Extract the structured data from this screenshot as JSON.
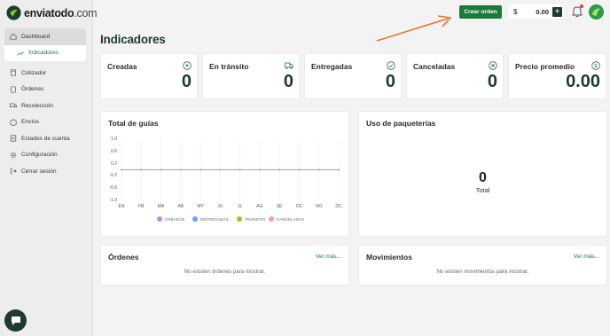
{
  "brand": {
    "name": "enviatodo",
    "domain": ".com"
  },
  "sidebar": {
    "items": [
      {
        "label": "Dashboard",
        "icon": "home-icon"
      },
      {
        "label": "Indicadores",
        "icon": "trend-icon"
      },
      {
        "label": "Cotizador",
        "icon": "calculator-icon"
      },
      {
        "label": "Órdenes",
        "icon": "orders-icon"
      },
      {
        "label": "Recolección",
        "icon": "truck-icon"
      },
      {
        "label": "Envíos",
        "icon": "box-icon"
      },
      {
        "label": "Estados de cuenta",
        "icon": "statement-icon"
      },
      {
        "label": "Configuración",
        "icon": "gear-icon"
      },
      {
        "label": "Cerrar sesión",
        "icon": "logout-icon"
      }
    ]
  },
  "topbar": {
    "create_order": "Crear orden",
    "currency": "$",
    "balance": "0.00",
    "add": "+"
  },
  "page": {
    "title": "Indicadores"
  },
  "kpis": [
    {
      "label": "Creadas",
      "value": "0",
      "icon": "plus-circle-icon"
    },
    {
      "label": "En tránsito",
      "value": "0",
      "icon": "truck-icon"
    },
    {
      "label": "Entregadas",
      "value": "0",
      "icon": "check-circle-icon"
    },
    {
      "label": "Canceladas",
      "value": "0",
      "icon": "x-circle-icon"
    },
    {
      "label": "Precio promedio",
      "value": "0.00",
      "icon": "dollar-circle-icon"
    }
  ],
  "guides": {
    "title": "Total de guías"
  },
  "chart_data": {
    "type": "line",
    "categories": [
      "EN",
      "FB",
      "MA",
      "AB",
      "MY",
      "JU",
      "JL",
      "AG",
      "SE",
      "OC",
      "NO",
      "DC"
    ],
    "series": [
      {
        "name": "CREADAS",
        "values": [
          0,
          0,
          0,
          0,
          0,
          0,
          0,
          0,
          0,
          0,
          0,
          0
        ],
        "color": "#b388ff"
      },
      {
        "name": "ENTREGADAS",
        "values": [
          0,
          0,
          0,
          0,
          0,
          0,
          0,
          0,
          0,
          0,
          0,
          0
        ],
        "color": "#64a6ff"
      },
      {
        "name": "TRÁNSITO",
        "values": [
          0,
          0,
          0,
          0,
          0,
          0,
          0,
          0,
          0,
          0,
          0,
          0
        ],
        "color": "#7ed321"
      },
      {
        "name": "CANCELADAS",
        "values": [
          0,
          0,
          0,
          0,
          0,
          0,
          0,
          0,
          0,
          0,
          0,
          0
        ],
        "color": "#f4a09a"
      }
    ],
    "yticks": [
      "1.0",
      "0.6",
      "0.2",
      "-0.2",
      "-0.6",
      "-1.0"
    ],
    "ylim": [
      -1.0,
      1.0
    ],
    "grid": "vertical",
    "legend": "bottom"
  },
  "carriers": {
    "title": "Uso de paqueterías",
    "total_value": "0",
    "total_label": "Total"
  },
  "orders": {
    "title": "Órdenes",
    "more": "Ver más...",
    "empty": "No existen órdenes para mostrar."
  },
  "movements": {
    "title": "Movimientos",
    "more": "Ver más...",
    "empty": "No existen movimientos para mostrar."
  },
  "colors": {
    "brand_green": "#1a7a3a",
    "dark_green": "#1f3b2f",
    "arrow": "#e8762c"
  }
}
